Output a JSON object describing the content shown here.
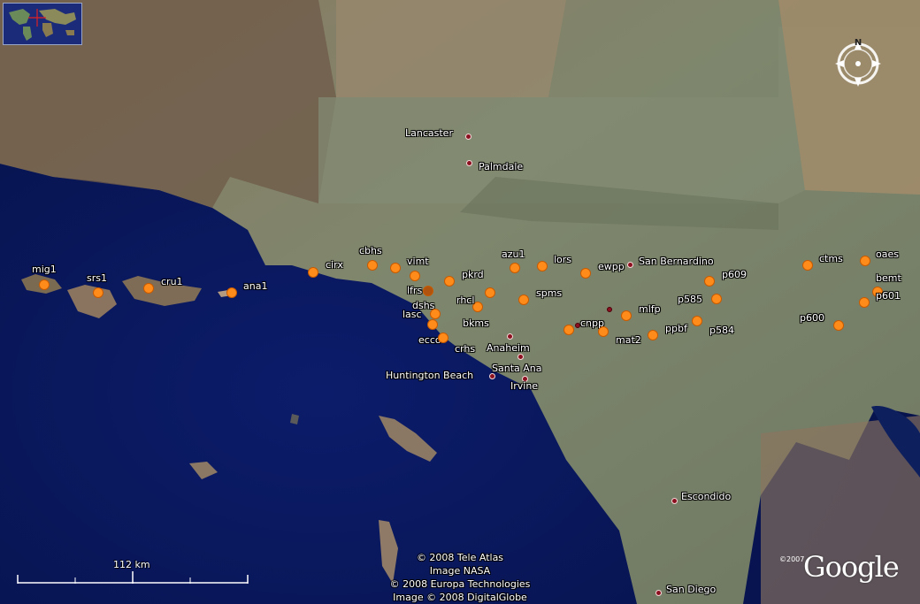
{
  "stations": [
    {
      "name": "mig1",
      "dot": [
        50,
        322
      ],
      "lbl": [
        36,
        299
      ]
    },
    {
      "name": "srs1",
      "dot": [
        111,
        331
      ],
      "lbl": [
        98,
        309
      ]
    },
    {
      "name": "cru1",
      "dot": [
        168,
        326
      ],
      "lbl": [
        182,
        313
      ]
    },
    {
      "name": "ana1",
      "dot": [
        262,
        331
      ],
      "lbl": [
        275,
        318
      ]
    },
    {
      "name": "cirx",
      "dot": [
        354,
        308
      ],
      "lbl": [
        368,
        294
      ]
    },
    {
      "name": "cbhs",
      "dot": [
        421,
        300
      ],
      "lbl": [
        406,
        278
      ]
    },
    {
      "name": "vimt",
      "dot": [
        447,
        303
      ],
      "lbl": [
        460,
        290
      ]
    },
    {
      "name": "lfrs",
      "dot": [
        469,
        312
      ],
      "lbl": [
        460,
        323
      ]
    },
    {
      "name": "dshs",
      "dot": [
        484,
        329
      ],
      "lbl": [
        466,
        340
      ],
      "dark": true
    },
    {
      "name": "pkrd",
      "dot": [
        508,
        318
      ],
      "lbl": [
        522,
        305
      ]
    },
    {
      "name": "rhcl",
      "dot": [
        540,
        347
      ],
      "lbl": [
        516,
        334
      ]
    },
    {
      "name": "lasc",
      "dot": [
        492,
        355
      ],
      "lbl": [
        455,
        350
      ]
    },
    {
      "name": "ecco",
      "dot": [
        489,
        367
      ],
      "lbl": [
        473,
        379
      ]
    },
    {
      "name": "bkms",
      "dot": [
        554,
        331
      ],
      "lbl": [
        523,
        360
      ]
    },
    {
      "name": "crhs",
      "dot": [
        501,
        382
      ],
      "lbl": [
        514,
        389
      ]
    },
    {
      "name": "azu1",
      "dot": [
        582,
        303
      ],
      "lbl": [
        567,
        282
      ]
    },
    {
      "name": "lors",
      "dot": [
        613,
        301
      ],
      "lbl": [
        626,
        288
      ]
    },
    {
      "name": "spms",
      "dot": [
        592,
        339
      ],
      "lbl": [
        606,
        326
      ]
    },
    {
      "name": "ewpp",
      "dot": [
        662,
        309
      ],
      "lbl": [
        676,
        296
      ]
    },
    {
      "name": "cnpp",
      "dot": [
        643,
        373
      ],
      "lbl": [
        656,
        360
      ]
    },
    {
      "name": "mat2",
      "dot": [
        682,
        375
      ],
      "lbl": [
        696,
        379
      ]
    },
    {
      "name": "mlfp",
      "dot": [
        708,
        357
      ],
      "lbl": [
        722,
        344
      ]
    },
    {
      "name": "ppbf",
      "dot": [
        738,
        379
      ],
      "lbl": [
        752,
        366
      ]
    },
    {
      "name": "p584",
      "dot": [
        788,
        363
      ],
      "lbl": [
        802,
        368
      ]
    },
    {
      "name": "p585",
      "dot": [
        810,
        338
      ],
      "lbl": [
        766,
        333
      ]
    },
    {
      "name": "p609",
      "dot": [
        802,
        318
      ],
      "lbl": [
        816,
        305
      ]
    },
    {
      "name": "ctms",
      "dot": [
        913,
        300
      ],
      "lbl": [
        926,
        287
      ]
    },
    {
      "name": "oaes",
      "dot": [
        978,
        295
      ],
      "lbl": [
        990,
        282
      ]
    },
    {
      "name": "bemt",
      "dot": [
        992,
        330
      ],
      "lbl": [
        990,
        309
      ]
    },
    {
      "name": "p601",
      "dot": [
        977,
        342
      ],
      "lbl": [
        990,
        329
      ]
    },
    {
      "name": "p600",
      "dot": [
        948,
        368
      ],
      "lbl": [
        904,
        354
      ]
    }
  ],
  "cities": [
    {
      "name": "Lancaster",
      "dot": [
        529,
        154
      ],
      "lbl": [
        458,
        145
      ],
      "outline": true
    },
    {
      "name": "Palmdale",
      "dot": [
        530,
        184
      ],
      "lbl": [
        541,
        183
      ],
      "outline": true
    },
    {
      "name": "San Bernardino",
      "dot": [
        712,
        299
      ],
      "lbl": [
        722,
        290
      ],
      "outline": true
    },
    {
      "name": "Anaheim",
      "dot": [
        576,
        380
      ],
      "lbl": [
        550,
        388
      ],
      "outline": true
    },
    {
      "name": "Santa Ana",
      "dot": [
        588,
        403
      ],
      "lbl": [
        556,
        411
      ],
      "outline": true
    },
    {
      "name": "Huntington Beach",
      "dot": [
        556,
        425
      ],
      "lbl": [
        436,
        419
      ],
      "outline": true
    },
    {
      "name": "Irvine",
      "dot": [
        593,
        428
      ],
      "lbl": [
        577,
        431
      ],
      "outline": true
    },
    {
      "name": "Escondido",
      "dot": [
        762,
        566
      ],
      "lbl": [
        770,
        556
      ],
      "outline": true
    },
    {
      "name": "San Diego",
      "dot": [
        744,
        670
      ],
      "lbl": [
        753,
        661
      ],
      "outline": true
    }
  ],
  "extra_markers": [
    [
      653,
      368
    ],
    [
      689,
      350
    ]
  ],
  "scale_label": "112 km",
  "credits": [
    "© 2008 Tele Atlas",
    "Image NASA",
    "© 2008 Europa Technologies",
    "Image © 2008 DigitalGlobe"
  ],
  "google": {
    "logo_text": "Google",
    "copyright": "©2007"
  },
  "compass_north": "N",
  "colors": {
    "ocean": "#0a1a5c",
    "land": "#7a846c",
    "desert": "#9b7c5e",
    "station": "#ff8c1a",
    "city": "#8b1020"
  }
}
